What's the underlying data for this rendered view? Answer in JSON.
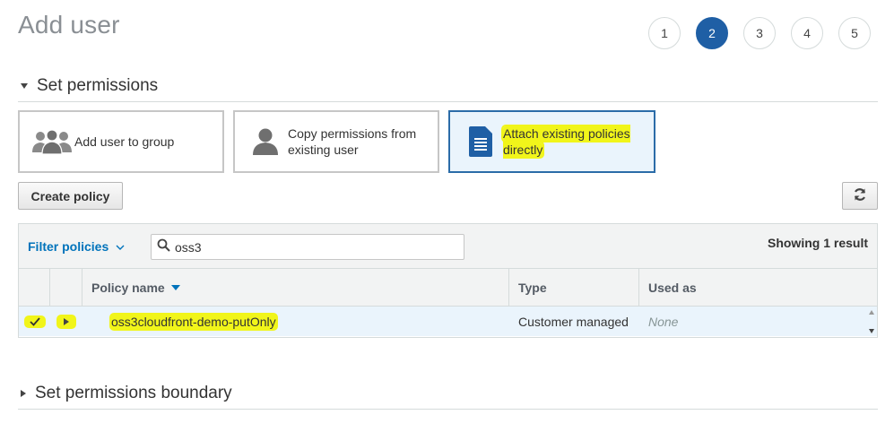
{
  "page": {
    "title": "Add user"
  },
  "steps": [
    "1",
    "2",
    "3",
    "4",
    "5"
  ],
  "active_step": 2,
  "permissions_section": {
    "label": "Set permissions",
    "expanded": true
  },
  "options": {
    "add_to_group": {
      "label": "Add user to group",
      "icon": "user-group-icon"
    },
    "copy_permissions": {
      "label": "Copy permissions from existing user",
      "icon": "user-icon"
    },
    "attach_policies": {
      "label": "Attach existing policies directly",
      "icon": "document-icon",
      "selected": true
    }
  },
  "toolbar": {
    "create_policy_label": "Create policy",
    "refresh_icon": "refresh-icon"
  },
  "policy_table": {
    "filter_label": "Filter policies",
    "search_value": "oss3",
    "search_icon": "search-icon",
    "result_count": "Showing 1 result",
    "columns": {
      "name": "Policy name",
      "type": "Type",
      "used_as": "Used as"
    },
    "rows": [
      {
        "checked": true,
        "name": "oss3cloudfront-demo-putOnly",
        "type": "Customer managed",
        "used_as": "None"
      }
    ]
  },
  "boundary_section": {
    "label": "Set permissions boundary",
    "expanded": false
  },
  "colors": {
    "accent": "#1f5fa5",
    "link": "#0073bb",
    "selected_bg": "#eaf4fc",
    "highlight": "#f1f51a"
  }
}
